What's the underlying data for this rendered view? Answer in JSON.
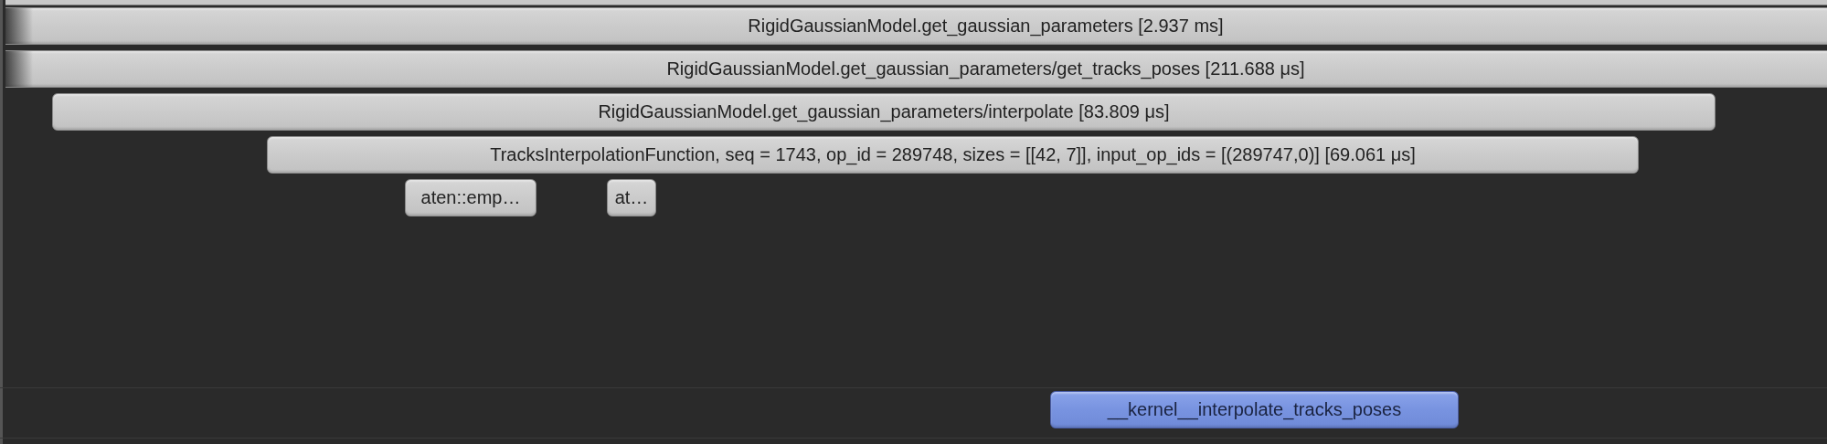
{
  "tracks": [
    {
      "kind": "cpu",
      "slices": [
        {
          "label": "RigidGaussianModel.get_gaussian_parameters [2.937 ms]",
          "children": [
            {
              "label": "RigidGaussianModel.get_gaussian_parameters/get_tracks_poses [211.688 μs]",
              "children": [
                {
                  "label": "RigidGaussianModel.get_gaussian_parameters/interpolate [83.809 μs]",
                  "children": [
                    {
                      "label": "TracksInterpolationFunction, seq = 1743, op_id = 289748, sizes = [[42, 7]], input_op_ids = [(289747,0)] [69.061 μs]",
                      "children": [
                        {
                          "label": "aten::emp…"
                        },
                        {
                          "label": "at…"
                        }
                      ]
                    }
                  ]
                }
              ]
            }
          ]
        }
      ]
    },
    {
      "kind": "gpu",
      "slices": [
        {
          "label": "__kernel__interpolate_tracks_poses"
        }
      ]
    }
  ]
}
